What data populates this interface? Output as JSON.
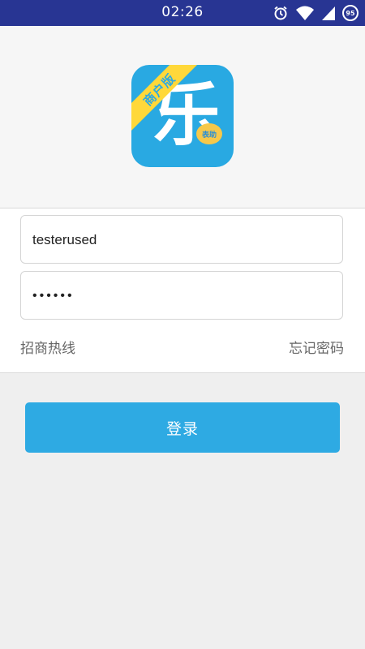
{
  "status_bar": {
    "time": "02:26",
    "icons": [
      "alarm-icon",
      "wifi-icon",
      "signal-icon",
      "battery-icon"
    ],
    "battery_level": "95"
  },
  "logo": {
    "badge": "商户版",
    "char": "乐",
    "sub": "表助",
    "colors": {
      "bg": "#29a9e2",
      "badge_bg": "#ffd83a"
    }
  },
  "form": {
    "username_value": "testerused",
    "password_value": "••••••"
  },
  "links": {
    "hotline": "招商热线",
    "forgot": "忘记密码"
  },
  "login_button": {
    "label": "登录",
    "color": "#2eaae3"
  }
}
